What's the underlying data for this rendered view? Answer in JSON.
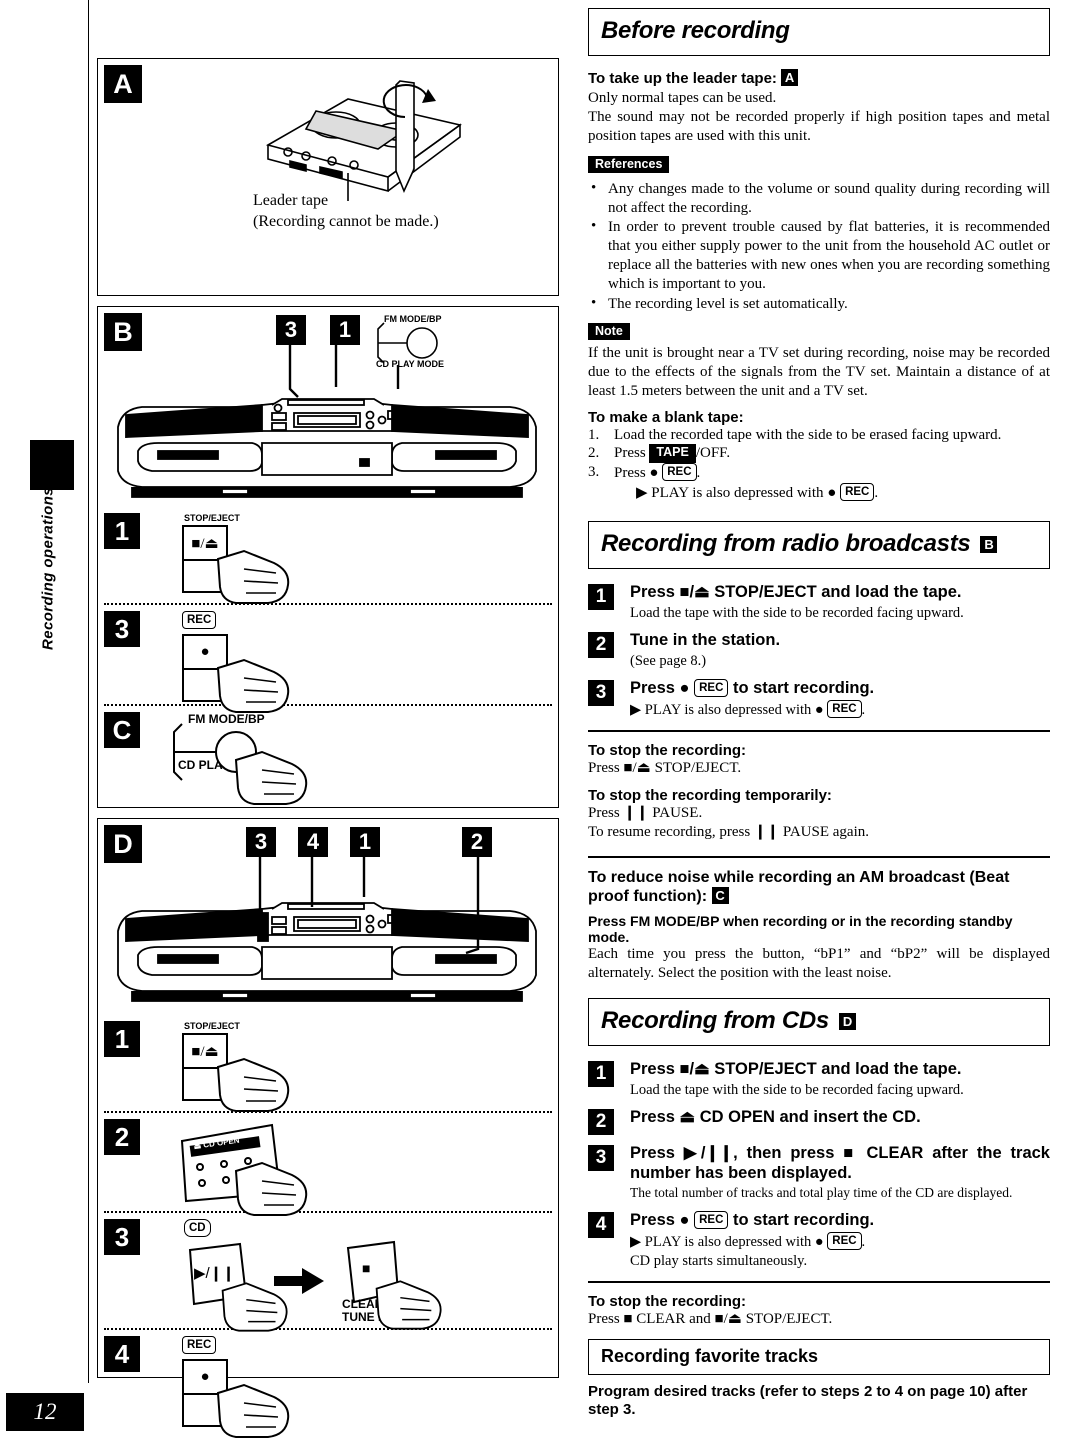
{
  "page": {
    "number": "12",
    "side_tab_label": "Recording operations"
  },
  "figures": {
    "panel_a": {
      "letter": "A",
      "caption_line1": "Leader tape",
      "caption_line2": "(Recording cannot be made.)",
      "art": "cassette-with-pencil-illustration"
    },
    "panel_b": {
      "letter": "B",
      "callouts": [
        "3",
        "1"
      ],
      "label_top": "FM MODE/BP",
      "label_bottom": "CD PLAY MODE",
      "art": "boombox-front-illustration",
      "steps": [
        {
          "badge": "1",
          "label": "STOP/EJECT",
          "glyph": "■/⏏",
          "art": "button-press-hand"
        },
        {
          "badge": "3",
          "label": "REC",
          "glyph": "●",
          "art": "button-press-hand"
        }
      ]
    },
    "panel_c": {
      "letter": "C",
      "label_top": "FM MODE/BP",
      "label_bottom": "CD PLAY MODE",
      "art": "knob-press-hand"
    },
    "panel_d": {
      "letter": "D",
      "callouts": [
        "3",
        "4",
        "1",
        "2"
      ],
      "art": "boombox-front-illustration",
      "steps": [
        {
          "badge": "1",
          "label": "STOP/EJECT",
          "glyph": "■/⏏",
          "art": "button-press-hand"
        },
        {
          "badge": "2",
          "label": "⏏ CD OPEN",
          "glyph": "",
          "art": "cd-open-panel-press-hand"
        },
        {
          "badge": "3",
          "label": "CD",
          "glyph": "▶/❙❙",
          "label2_line1": "CLEAR",
          "label2_line2": "TUNE MODE",
          "glyph2": "■",
          "art": "two-buttons-arrow-press-hand"
        },
        {
          "badge": "4",
          "label": "REC",
          "glyph": "●",
          "art": "button-press-hand"
        }
      ]
    }
  },
  "before_recording": {
    "heading": "Before recording",
    "leader_heading": "To take up the leader tape:",
    "leader_letter": "A",
    "leader_p1": "Only normal tapes can be used.",
    "leader_p2": "The sound may not be recorded properly if high position tapes and metal position tapes are used with this unit.",
    "references_tag": "References",
    "references": [
      "Any changes made to the volume or sound quality during recording will not affect the recording.",
      "In order to prevent trouble caused by flat batteries, it is recommended that you either supply power to the unit from the household AC outlet or replace all the batteries with new ones when you are recording something which is important to you.",
      "The recording level is set automatically."
    ],
    "note_tag": "Note",
    "note_text": "If the unit is brought near a TV set during recording, noise may be recorded due to the effects of the signals from the TV set. Maintain a distance of at least 1.5 meters between the unit and a TV set.",
    "blank_tape_heading": "To make a blank tape:",
    "blank_tape_steps": [
      {
        "n": "1.",
        "pre": "Load the recorded tape with the side to be erased facing upward.",
        "post": ""
      },
      {
        "n": "2.",
        "pre": "Press ",
        "tag": "TAPE",
        "post": "/OFF."
      },
      {
        "n": "3.",
        "pre": "Press ● ",
        "keycap": "REC",
        "post": "."
      }
    ],
    "blank_tape_note_pre": "▶ PLAY is also depressed with ● ",
    "blank_tape_note_keycap": "REC",
    "blank_tape_note_post": "."
  },
  "radio_section": {
    "heading": "Recording from radio broadcasts",
    "heading_letter": "B",
    "steps": [
      {
        "num": "1",
        "title": "Press ■/⏏ STOP/EJECT and load the tape.",
        "sub": "Load the tape with the side to be recorded facing upward."
      },
      {
        "num": "2",
        "title": "Tune in the station.",
        "sub": "(See page 8.)"
      },
      {
        "num": "3",
        "title_pre": "Press ● ",
        "title_keycap": "REC",
        "title_post": " to start recording.",
        "sub_pre": "▶ PLAY is also depressed with ● ",
        "sub_keycap": "REC",
        "sub_post": "."
      }
    ],
    "stop_heading": "To stop the recording:",
    "stop_text": "Press ■/⏏ STOP/EJECT.",
    "pause_heading": "To stop the recording temporarily:",
    "pause_text1": "Press ❙❙ PAUSE.",
    "pause_text2": "To resume recording, press ❙❙ PAUSE again.",
    "beat_heading_line1": "To reduce noise while recording an AM broadcast (Beat",
    "beat_heading_line2": "proof function):",
    "beat_letter": "C",
    "beat_bold": "Press FM MODE/BP when recording or in the recording standby mode.",
    "beat_text": "Each time you press the button, “bP1” and “bP2” will be displayed alternately. Select the position with the least noise."
  },
  "cd_section": {
    "heading": "Recording from CDs",
    "heading_letter": "D",
    "steps": [
      {
        "num": "1",
        "title": "Press ■/⏏ STOP/EJECT and load the tape.",
        "sub": "Load the tape with the side to be recorded facing upward."
      },
      {
        "num": "2",
        "title": "Press ⏏ CD OPEN and insert the CD.",
        "sub": ""
      },
      {
        "num": "3",
        "title": "Press ▶/❙❙, then press ■ CLEAR after the track number has been displayed.",
        "sub": "The total number of tracks and total play time of the CD are displayed."
      },
      {
        "num": "4",
        "title_pre": "Press ● ",
        "title_keycap": "REC",
        "title_post": " to start recording.",
        "sub_pre": "▶ PLAY is also depressed with ● ",
        "sub_keycap": "REC",
        "sub_post": ".",
        "sub2": "CD play starts simultaneously."
      }
    ],
    "stop_heading": "To stop the recording:",
    "stop_text": "Press ■ CLEAR and ■/⏏ STOP/EJECT.",
    "favorite_heading": "Recording favorite tracks",
    "favorite_text": "Program desired tracks (refer to steps 2 to 4 on page 10) after step 3."
  }
}
